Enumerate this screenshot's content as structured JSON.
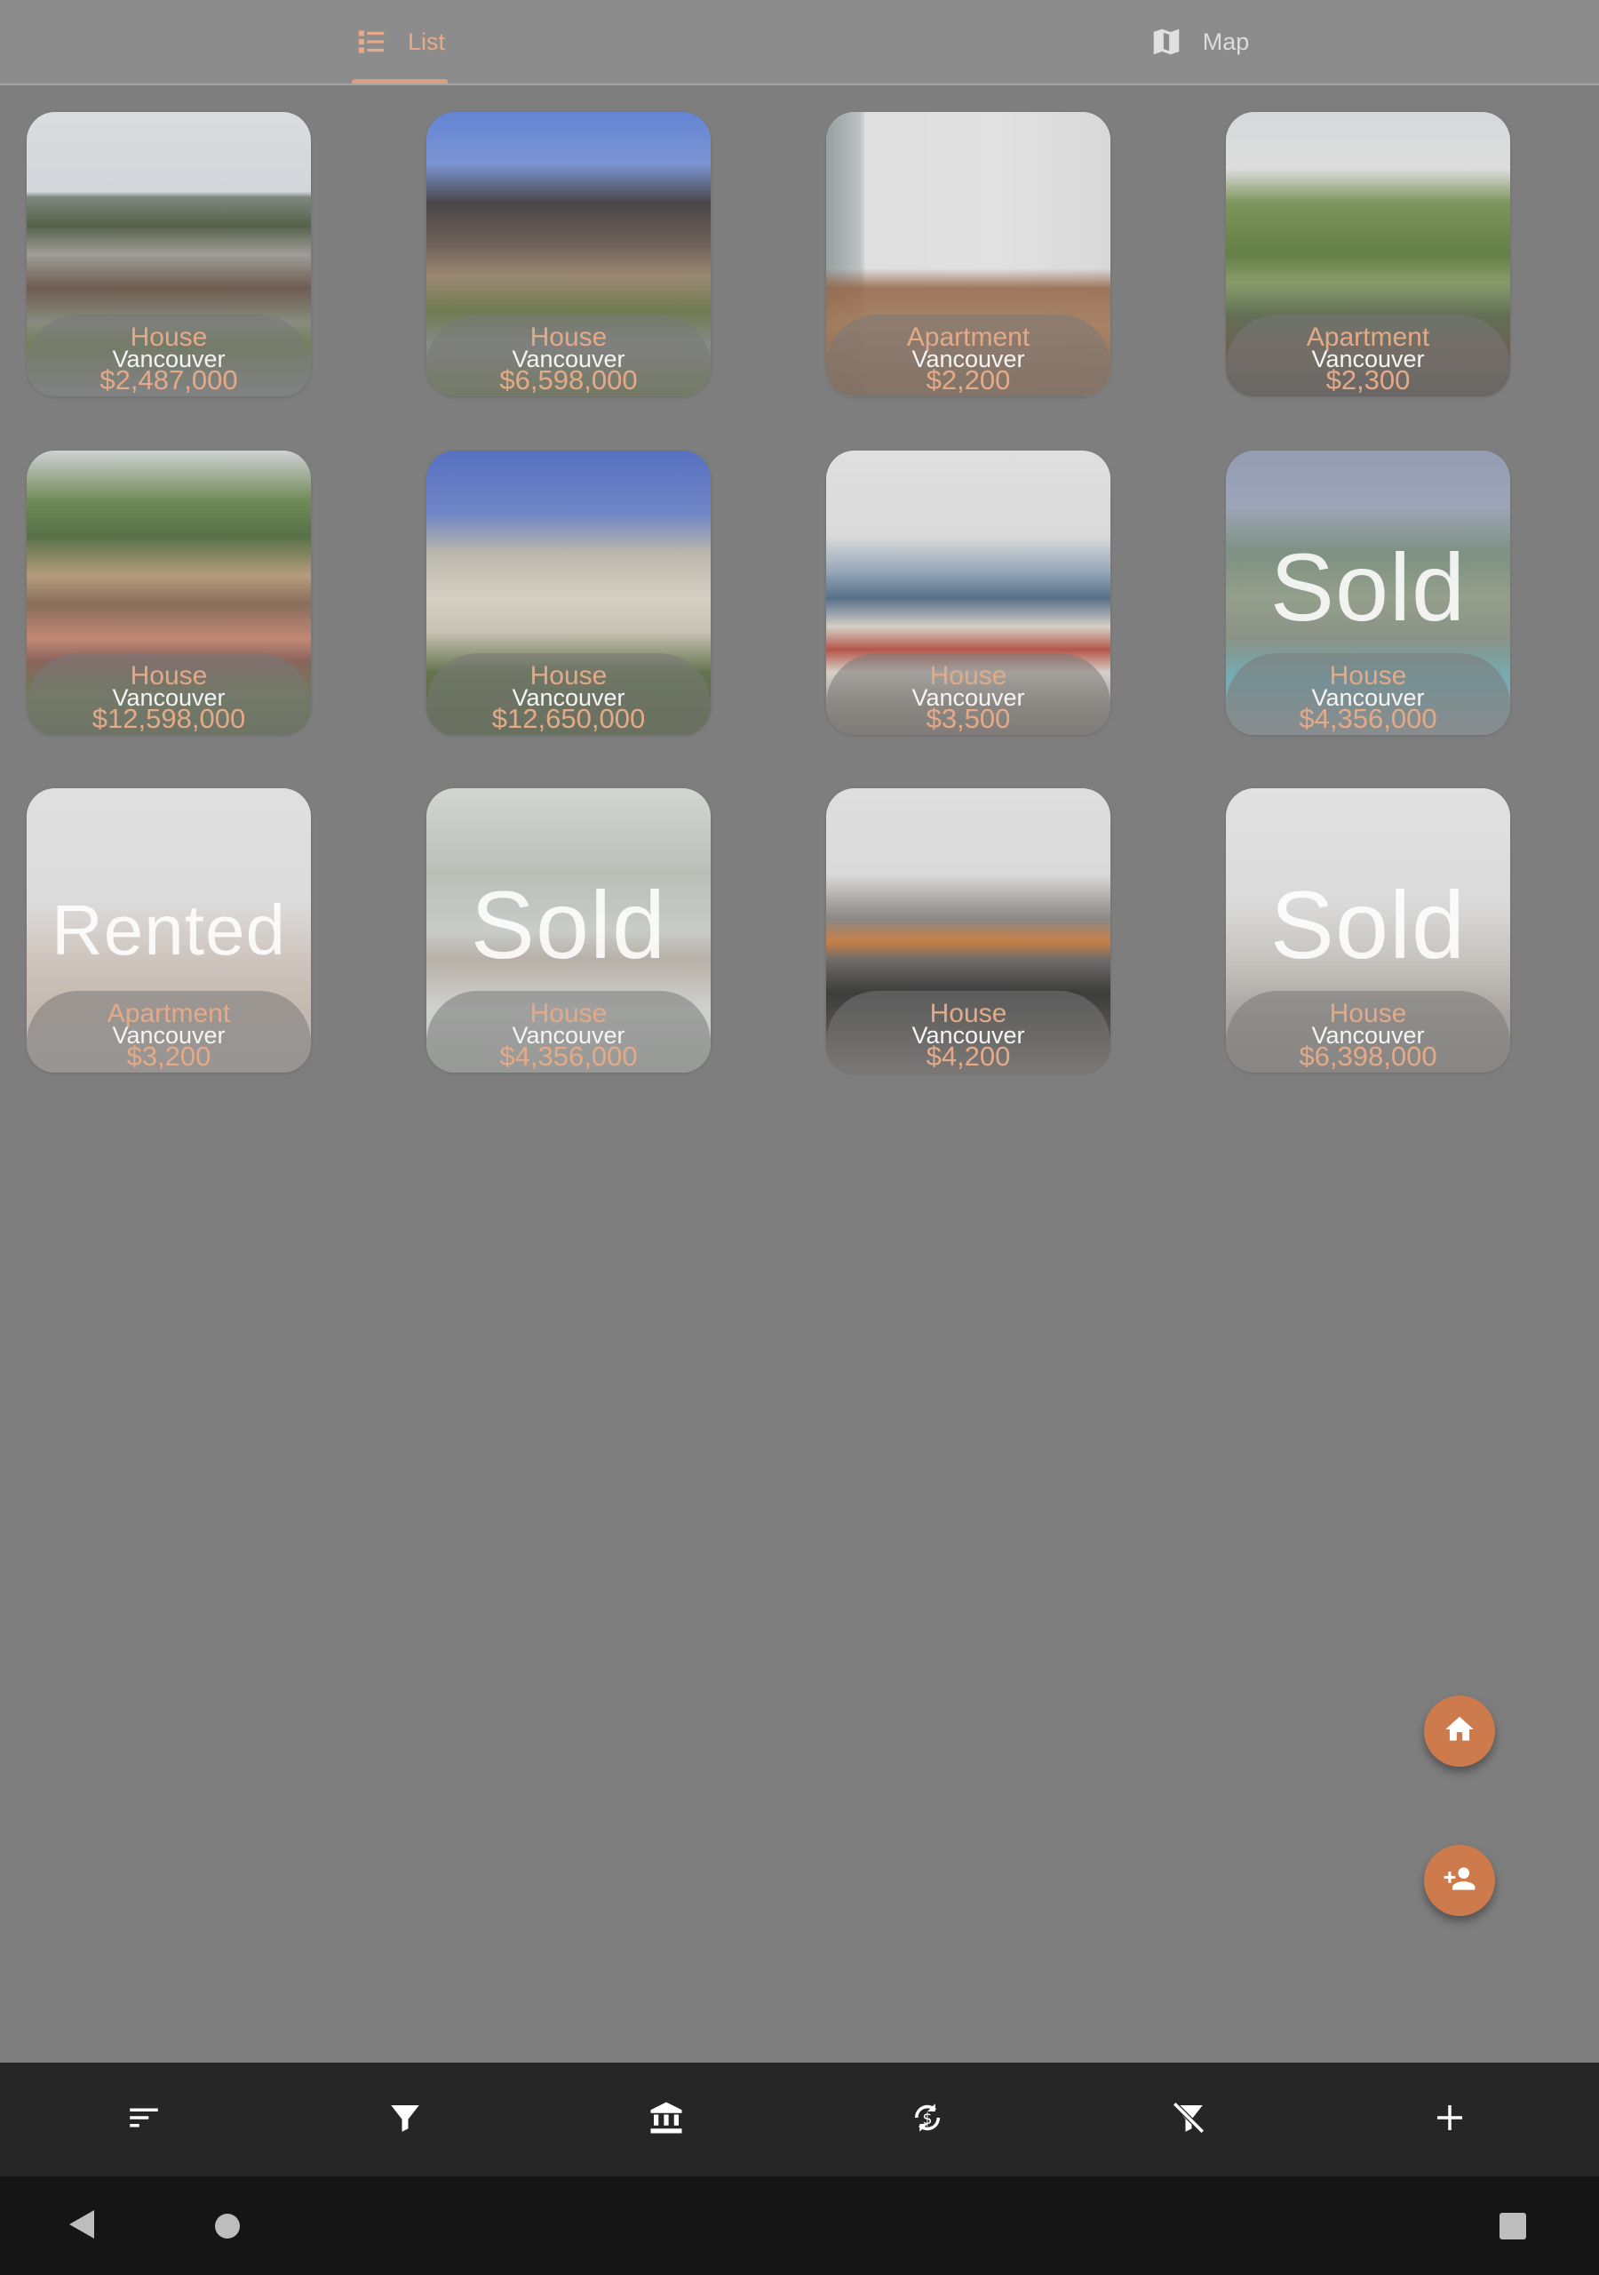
{
  "tabs": [
    {
      "label": "List",
      "icon": "list-icon",
      "active": true
    },
    {
      "label": "Map",
      "icon": "map-icon",
      "active": false
    }
  ],
  "listings": [
    {
      "type": "House",
      "city": "Vancouver",
      "price": "$2,487,000",
      "status": "",
      "photo": "house-exterior-garage"
    },
    {
      "type": "House",
      "city": "Vancouver",
      "price": "$6,598,000",
      "status": "",
      "photo": "house-exterior-dusk"
    },
    {
      "type": "Apartment",
      "city": "Vancouver",
      "price": "$2,200",
      "status": "",
      "photo": "apartment-living-room"
    },
    {
      "type": "Apartment",
      "city": "Vancouver",
      "price": "$2,300",
      "status": "",
      "photo": "apartment-balcony"
    },
    {
      "type": "House",
      "city": "Vancouver",
      "price": "$12,598,000",
      "status": "",
      "photo": "house-garden-exterior"
    },
    {
      "type": "House",
      "city": "Vancouver",
      "price": "$12,650,000",
      "status": "",
      "photo": "house-white-exterior-dusk"
    },
    {
      "type": "House",
      "city": "Vancouver",
      "price": "$3,500",
      "status": "",
      "photo": "house-living-room"
    },
    {
      "type": "House",
      "city": "Vancouver",
      "price": "$4,356,000",
      "status": "Sold",
      "photo": "house-hillside"
    },
    {
      "type": "Apartment",
      "city": "Vancouver",
      "price": "$3,200",
      "status": "Rented",
      "photo": "apartment-dining-room"
    },
    {
      "type": "House",
      "city": "Vancouver",
      "price": "$4,356,000",
      "status": "Sold",
      "photo": "house-forest"
    },
    {
      "type": "House",
      "city": "Vancouver",
      "price": "$4,200",
      "status": "",
      "photo": "house-fireplace-room"
    },
    {
      "type": "House",
      "city": "Vancouver",
      "price": "$6,398,000",
      "status": "Sold",
      "photo": "house-bright-interior"
    }
  ],
  "fabs": [
    {
      "name": "add-property-fab",
      "icon": "home-icon"
    },
    {
      "name": "add-agent-fab",
      "icon": "person-add-icon"
    }
  ],
  "bottom_actions": [
    {
      "name": "sort-button",
      "icon": "sort-icon"
    },
    {
      "name": "filter-button",
      "icon": "filter-icon"
    },
    {
      "name": "mortgage-button",
      "icon": "bank-icon"
    },
    {
      "name": "currency-convert-button",
      "icon": "currency-exchange-icon"
    },
    {
      "name": "clear-filter-button",
      "icon": "filter-off-icon"
    },
    {
      "name": "add-button",
      "icon": "plus-icon"
    }
  ],
  "system_nav": [
    {
      "name": "back-button",
      "icon": "back-triangle-icon"
    },
    {
      "name": "home-button",
      "icon": "home-circle-icon"
    },
    {
      "name": "recents-button",
      "icon": "recents-square-icon"
    }
  ],
  "colors": {
    "accent": "#cd7a4d",
    "accent_text": "#e4aa88",
    "background": "#7e7e7e",
    "bottom_bar": "#262626",
    "nav_bar": "#151515"
  }
}
